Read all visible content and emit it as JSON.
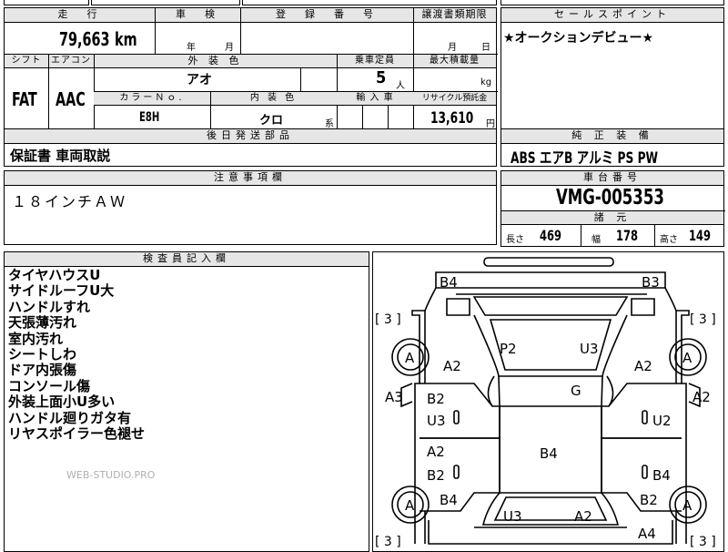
{
  "top_strip": {
    "partial": "蕗雑形"
  },
  "row1": {
    "mileage_header": "走　行",
    "mileage_value": "79,663",
    "mileage_unit": "km",
    "inspection_header": "車　検",
    "inspection_year": "年",
    "inspection_month": "月",
    "registration_header": "登　録　番　号",
    "registration_value": "",
    "transfer_header": "譲渡書類期限",
    "transfer_month": "月",
    "transfer_day": "日"
  },
  "sales_point": {
    "header": "セールスポイント",
    "text": "★オークションデビュー★"
  },
  "row2": {
    "shift_header": "シフト",
    "shift_value": "FAT",
    "aircon_header": "エアコン",
    "aircon_value": "AAC",
    "exterior_color_header": "外 装 色",
    "exterior_color_value": "アオ",
    "capacity_header": "乗車定員",
    "capacity_value": "5",
    "capacity_unit": "人",
    "max_load_header": "最大積載量",
    "max_load_unit": "kg",
    "color_no_header": "カラーＮｏ.",
    "color_no_value": "E8H",
    "interior_color_header": "内 装 色",
    "interior_color_value": "クロ",
    "interior_color_suffix": "系",
    "import_header": "輸 入 車",
    "recycle_header": "リサイクル預託金",
    "recycle_value": "13,610",
    "recycle_unit": "円"
  },
  "later_parts": {
    "header": "後日発送部品",
    "text": "保証書 車両取説"
  },
  "equipment": {
    "header": "純 正 装 備",
    "text": "ABS エアB アルミ PS PW"
  },
  "caution": {
    "header": "注意事項欄",
    "text": "１８インチＡＷ"
  },
  "chassis": {
    "header": "車台番号",
    "value": "VMG-005353"
  },
  "specs": {
    "header": "諸 元",
    "length_label": "長さ",
    "length_value": "469",
    "width_label": "幅",
    "width_value": "178",
    "height_label": "高さ",
    "height_value": "149"
  },
  "inspector": {
    "header": "検査員記入欄",
    "notes": [
      "タイヤハウスU",
      "サイドルーフU大",
      "ハンドルすれ",
      "天張薄汚れ",
      "室内汚れ",
      "シートしわ",
      "ドア内張傷",
      "コンソール傷",
      "外装上面小U多い",
      "ハンドル廻りガタ有",
      "リヤスポイラー色褪せ"
    ],
    "watermark": "WEB-STUDIO.PRO"
  },
  "diagram": {
    "marks": {
      "top_left": "B4",
      "top_right": "B3",
      "tire_bracket": "[ 3 ]",
      "tire_grade": "A",
      "p2": "P2",
      "u3_roof": "U3",
      "a2_left_fender": "A2",
      "a2_right_fender": "A2",
      "g": "G",
      "a3": "A3",
      "a2_right_side": "A2",
      "b2_fl_door": "B2",
      "u3_fl_door": "U3",
      "u2_fr_door": "U2",
      "b4_center": "B4",
      "a2_rl_door": "A2",
      "b2_rl_door": "B2",
      "b4_rr_door": "B4",
      "b4_rear_left": "B4",
      "b2_rear_right": "B2",
      "u3_rear": "U3",
      "a2_rear": "A2",
      "a4_rear": "A4"
    }
  }
}
